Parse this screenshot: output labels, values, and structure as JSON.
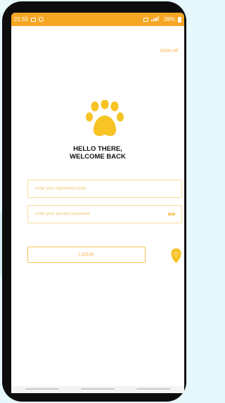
{
  "status_bar": {
    "time": "21:55",
    "battery": "39%"
  },
  "header": {
    "sign_up_label": "SIGN UP"
  },
  "greeting": {
    "line1": "HELLO THERE,",
    "line2": "WELCOME BACK"
  },
  "form": {
    "email_placeholder": "Enter your registered email",
    "password_placeholder": "Enter your account password",
    "login_label": "LOGIN"
  },
  "icons": [
    "paw-icon",
    "eye-icon",
    "fingerprint-icon"
  ],
  "colors": {
    "accent": "#f5a623",
    "paw": "#f7c325",
    "border": "#f8dca0"
  }
}
